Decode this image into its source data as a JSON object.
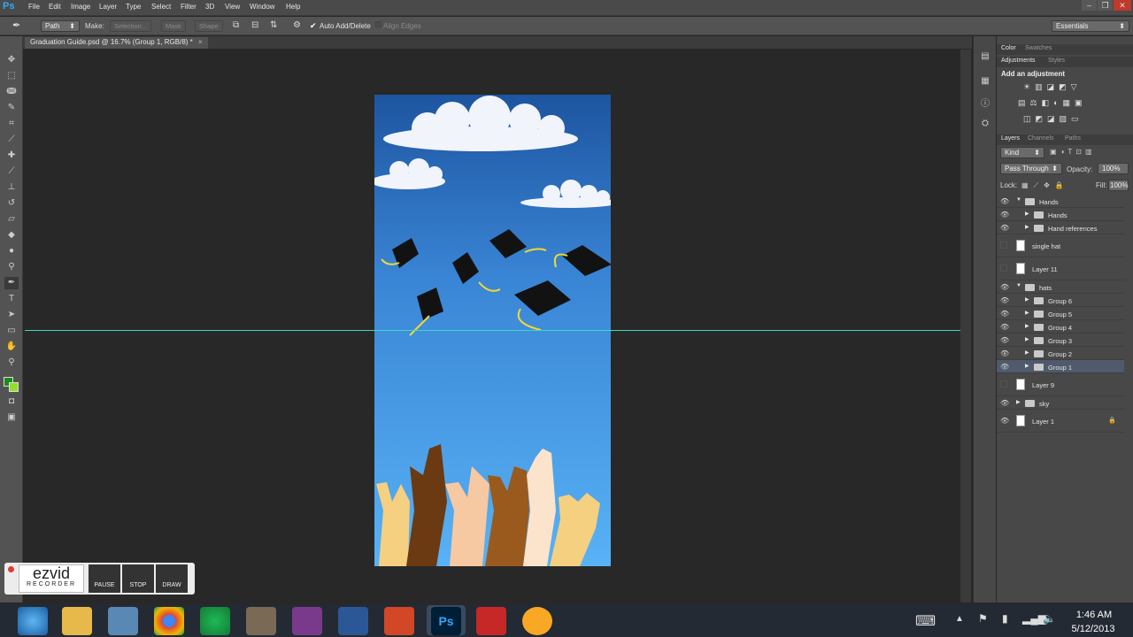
{
  "menubar": {
    "logo": "Ps",
    "items": [
      "File",
      "Edit",
      "Image",
      "Layer",
      "Type",
      "Select",
      "Filter",
      "3D",
      "View",
      "Window",
      "Help"
    ]
  },
  "options": {
    "tool_mode": "Path",
    "make_label": "Make:",
    "selection": "Selection...",
    "mask": "Mask",
    "shape": "Shape",
    "auto_add": "Auto Add/Delete",
    "align_edges": "Align Edges",
    "workspace": "Essentials"
  },
  "document": {
    "tab_title": "Graduation Guide.psd @ 16.7% (Group 1, RGB/8) *"
  },
  "panels": {
    "top_tabs": [
      "Color",
      "Swatches"
    ],
    "adj_tabs": [
      "Adjustments",
      "Styles"
    ],
    "add_adjustment": "Add an adjustment",
    "layer_tabs": [
      "Layers",
      "Channels",
      "Paths"
    ],
    "kind": "Kind",
    "blend": "Pass Through",
    "opacity_label": "Opacity:",
    "opacity": "100%",
    "lock_label": "Lock:",
    "fill_label": "Fill:",
    "fill": "100%"
  },
  "layers": [
    {
      "name": "Hands",
      "type": "group",
      "open": true,
      "indent": 0,
      "eye": true,
      "selected": false
    },
    {
      "name": "Hands",
      "type": "group",
      "open": false,
      "indent": 1,
      "eye": true,
      "selected": false
    },
    {
      "name": "Hand references",
      "type": "group",
      "open": false,
      "indent": 1,
      "eye": true,
      "selected": false
    },
    {
      "name": "single hat",
      "type": "layer",
      "indent": 0,
      "eye": false,
      "selected": false
    },
    {
      "name": "Layer 11",
      "type": "layer",
      "indent": 0,
      "eye": false,
      "selected": false
    },
    {
      "name": "hats",
      "type": "group",
      "open": true,
      "indent": 0,
      "eye": true,
      "selected": false
    },
    {
      "name": "Group 6",
      "type": "group",
      "open": false,
      "indent": 1,
      "eye": true,
      "selected": false
    },
    {
      "name": "Group 5",
      "type": "group",
      "open": false,
      "indent": 1,
      "eye": true,
      "selected": false
    },
    {
      "name": "Group 4",
      "type": "group",
      "open": false,
      "indent": 1,
      "eye": true,
      "selected": false
    },
    {
      "name": "Group 3",
      "type": "group",
      "open": false,
      "indent": 1,
      "eye": true,
      "selected": false
    },
    {
      "name": "Group 2",
      "type": "group",
      "open": false,
      "indent": 1,
      "eye": true,
      "selected": false
    },
    {
      "name": "Group 1",
      "type": "group",
      "open": false,
      "indent": 1,
      "eye": true,
      "selected": true
    },
    {
      "name": "Layer 9",
      "type": "layer",
      "indent": 0,
      "eye": false,
      "selected": false
    },
    {
      "name": "sky",
      "type": "group",
      "open": false,
      "indent": 0,
      "eye": true,
      "selected": false
    },
    {
      "name": "Layer 1",
      "type": "layer",
      "indent": 0,
      "eye": true,
      "selected": false,
      "locked": true
    }
  ],
  "ezvid": {
    "logo_top": "ezvid",
    "logo_bottom": "RECORDER",
    "pause": "PAUSE",
    "stop": "STOP",
    "draw": "DRAW"
  },
  "taskbar": {
    "time": "1:46 AM",
    "date": "5/12/2013",
    "apps": [
      "Internet Explorer",
      "File Explorer",
      "Ezvid",
      "Chrome",
      "Spotify",
      "GIMP",
      "OneNote",
      "Word",
      "PowerPoint",
      "Photoshop",
      "Snagit",
      "Media Player"
    ]
  },
  "colors": {
    "foreground": "#1e8a1e",
    "background": "#8ee02a",
    "doc_sky_top": "#1d55a0",
    "doc_sky_bottom": "#58b2f5",
    "guide": "#3ed6c2"
  }
}
